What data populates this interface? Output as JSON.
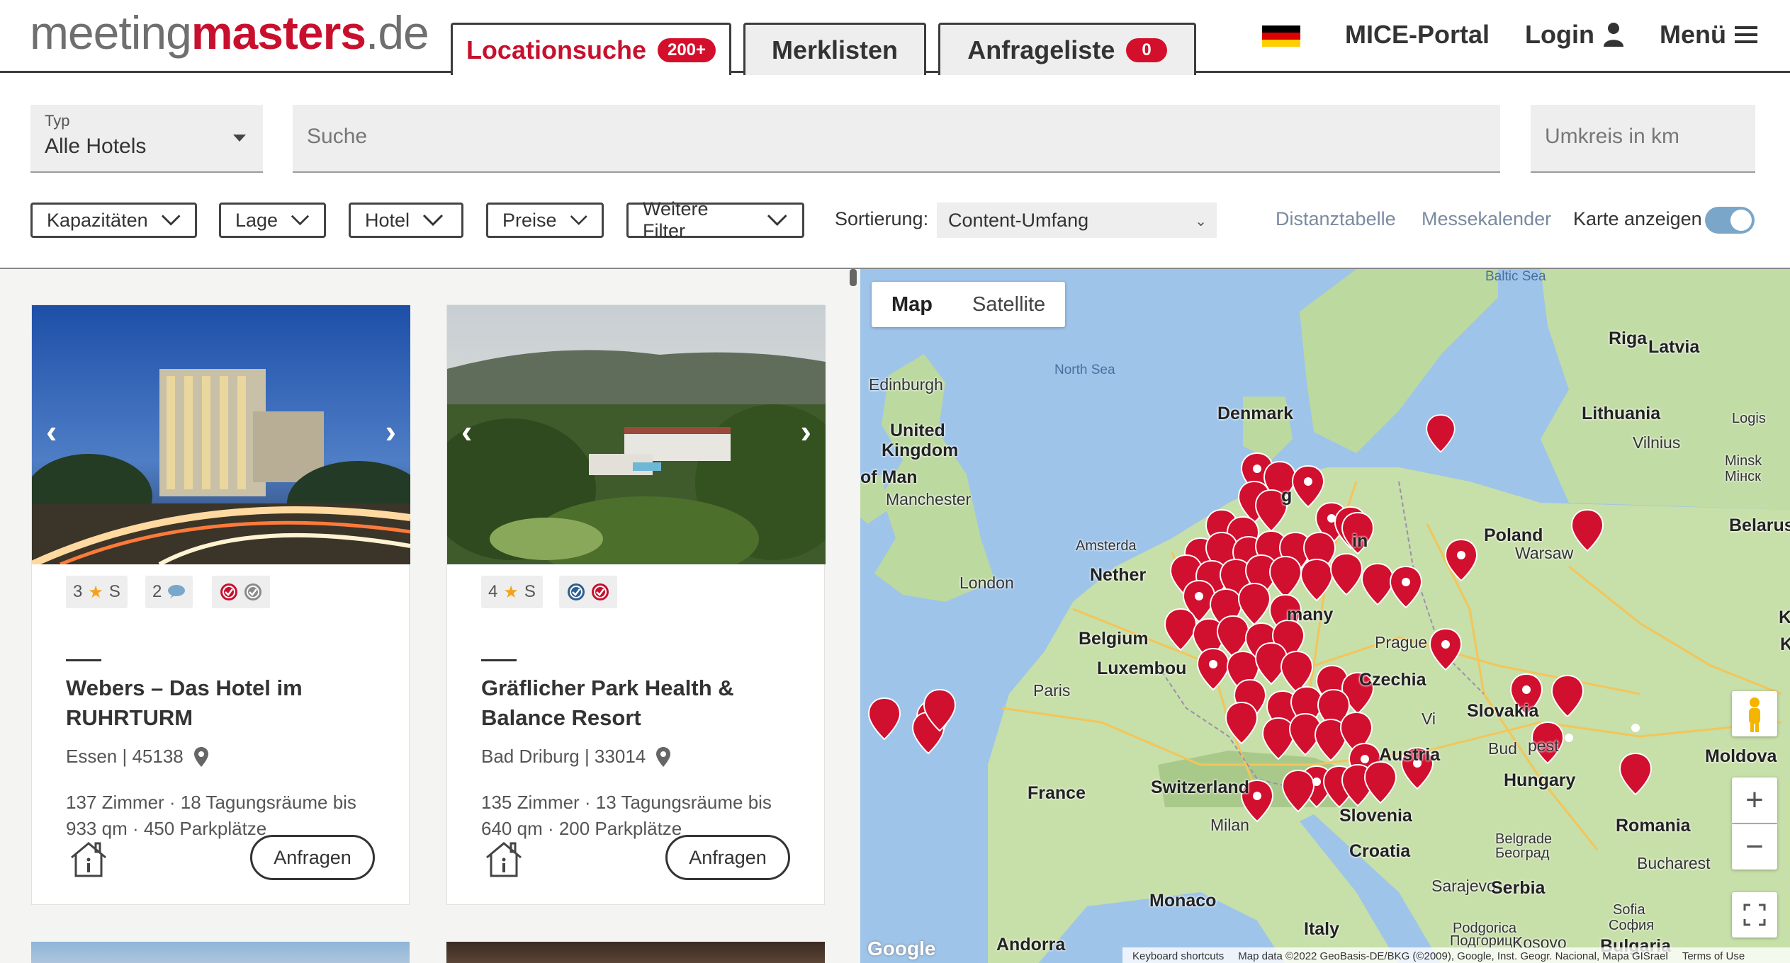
{
  "header": {
    "logo": {
      "part1": "meeting",
      "part2": "masters",
      "part3": ".de"
    },
    "tabs": [
      {
        "label": "Locationsuche",
        "badge": "200+"
      },
      {
        "label": "Merklisten"
      },
      {
        "label": "Anfrageliste",
        "badge": "0"
      }
    ],
    "flag": "flag-de-icon",
    "mice": "MICE-Portal",
    "login": "Login",
    "menu": "Menü"
  },
  "search": {
    "type_label": "Typ",
    "type_value": "Alle Hotels",
    "search_placeholder": "Suche",
    "radius_placeholder": "Umkreis in km"
  },
  "filters": {
    "items": [
      "Kapazitäten",
      "Lage",
      "Hotel",
      "Preise",
      "Weitere Filter"
    ],
    "sort_label": "Sortierung:",
    "sort_value": "Content-Umfang",
    "distance_table": "Distanztabelle",
    "fair_calendar": "Messekalender",
    "show_map": "Karte anzeigen",
    "show_map_on": true
  },
  "hotels": [
    {
      "stars": "3",
      "category": "S",
      "reviews": "2",
      "title": "Webers – Das Hotel im RUHRTURM",
      "location": "Essen | 45138",
      "facts": "137 Zimmer · 18 Tagungsräume bis 933 qm · 450 Parkplätze",
      "cta": "Anfragen"
    },
    {
      "stars": "4",
      "category": "S",
      "title": "Gräflicher Park Health & Balance Resort",
      "location": "Bad Driburg | 33014",
      "facts": "135 Zimmer · 13 Tagungsräume bis 640 qm · 200 Parkplätze",
      "cta": "Anfragen"
    }
  ],
  "map": {
    "type_map": "Map",
    "type_satellite": "Satellite",
    "labels": {
      "baltic": "Baltic Sea",
      "north_sea": "North Sea",
      "riga": "Riga",
      "latvia": "Latvia",
      "edinburgh": "Edinburgh",
      "denmark": "Denmark",
      "uk1": "United",
      "uk2": "Kingdom",
      "lithuania": "Lithuania",
      "vilnius": "Vilnius",
      "isle_of_man": "of Man",
      "manchester": "Manchester",
      "minsk1": "Minsk",
      "minsk2": "Мінск",
      "belarus": "Belarus",
      "poland": "Poland",
      "amsterdam": "Amsterda",
      "warsaw": "Warsaw",
      "netherlands": "Nether",
      "london": "London",
      "belgium": "Belgium",
      "luxembourg": "Luxembou",
      "prague": "Prague",
      "czechia": "Czechia",
      "paris": "Paris",
      "vienna": "Vi",
      "slovakia": "Slovakia",
      "budapest": "Bud",
      "budapest2": "pest",
      "moldova": "Moldova",
      "austria": "Austria",
      "hungary": "Hungary",
      "france": "France",
      "switzerland": "Switzerland",
      "slovenia": "Slovenia",
      "milan": "Milan",
      "romania": "Romania",
      "croatia": "Croatia",
      "belgrade1": "Belgrade",
      "belgrade2": "Београд",
      "bucharest": "Bucharest",
      "sarajevo": "Sarajevo",
      "serbia": "Serbia",
      "monaco": "Monaco",
      "sofia1": "Sofia",
      "sofia2": "София",
      "italy": "Italy",
      "podgorica1": "Podgorica",
      "podgorica2": "Подгорица",
      "kosovo": "Kosovo",
      "bulgaria": "Bulgaria",
      "andorra": "Andorra",
      "logis": "Logis",
      "many": "many",
      "edge_k1": "K",
      "edge_k2": "K",
      "ng": "g",
      "in": "in"
    },
    "footer": {
      "shortcuts": "Keyboard shortcuts",
      "attribution": "Map data ©2022 GeoBasis-DE/BKG (©2009), Google, Inst. Geogr. Nacional, Mapa GISrael",
      "terms": "Terms of Use"
    },
    "google": "Google",
    "zoom_in": "+",
    "zoom_out": "−"
  },
  "colors": {
    "brand_red": "#c8102e",
    "badge_red": "#d40f2b",
    "link_blue": "#7a8aa0",
    "toggle_on": "#7aa7c9"
  }
}
